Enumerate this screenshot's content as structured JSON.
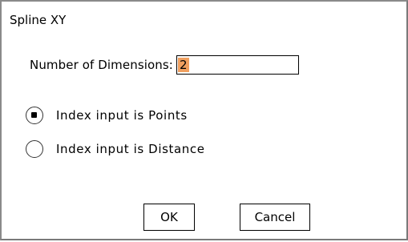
{
  "dialog": {
    "title": "Spline XY",
    "dimensions": {
      "label": "Number of Dimensions:",
      "value": "2"
    },
    "options": [
      {
        "label": "Index input is Points",
        "checked": true
      },
      {
        "label": "Index input is Distance",
        "checked": false
      }
    ],
    "buttons": {
      "ok_label": "OK",
      "cancel_label": "Cancel"
    }
  }
}
